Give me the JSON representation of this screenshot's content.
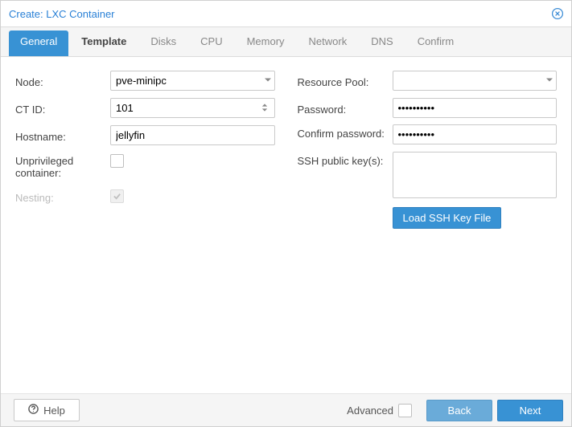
{
  "window": {
    "title": "Create: LXC Container"
  },
  "tabs": {
    "general": "General",
    "template": "Template",
    "disks": "Disks",
    "cpu": "CPU",
    "memory": "Memory",
    "network": "Network",
    "dns": "DNS",
    "confirm": "Confirm"
  },
  "left": {
    "node_label": "Node:",
    "node_value": "pve-minipc",
    "ctid_label": "CT ID:",
    "ctid_value": "101",
    "hostname_label": "Hostname:",
    "hostname_value": "jellyfin",
    "unpriv_label": "Unprivileged container:",
    "nesting_label": "Nesting:"
  },
  "right": {
    "pool_label": "Resource Pool:",
    "pool_value": "",
    "password_label": "Password:",
    "password_value": "••••••••••",
    "confirm_label": "Confirm password:",
    "confirm_value": "••••••••••",
    "ssh_label": "SSH public key(s):",
    "ssh_value": "",
    "load_ssh_button": "Load SSH Key File"
  },
  "footer": {
    "help": "Help",
    "advanced": "Advanced",
    "back": "Back",
    "next": "Next"
  }
}
